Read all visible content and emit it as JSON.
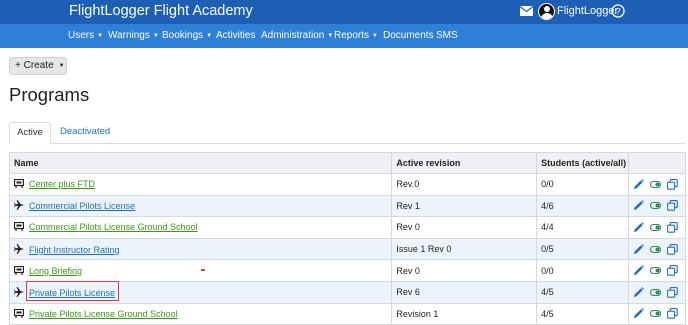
{
  "header": {
    "brand": "FlightLogger Flight Academy",
    "user_name": "FlightLogger"
  },
  "nav": {
    "items": [
      {
        "label": "Users",
        "caret": true
      },
      {
        "label": "Warnings",
        "caret": true
      },
      {
        "label": "Bookings",
        "caret": true
      },
      {
        "label": "Activities",
        "caret": false
      },
      {
        "label": "Administration",
        "caret": true
      },
      {
        "label": "Reports",
        "caret": true
      },
      {
        "label": "Documents",
        "caret": false
      },
      {
        "label": "SMS",
        "caret": false
      }
    ]
  },
  "toolbar": {
    "create_label": "+ Create"
  },
  "page": {
    "title": "Programs"
  },
  "tabs": {
    "active": "Active",
    "deactivated": "Deactivated"
  },
  "table": {
    "headers": {
      "name": "Name",
      "revision": "Active revision",
      "students": "Students (active/all)"
    },
    "rows": [
      {
        "icon": "simulator-icon",
        "name": "Center plus FTD",
        "revision": "Rev.0",
        "students": "0/0",
        "link_color": "green"
      },
      {
        "icon": "airplane-icon",
        "name": "Commercial Pilots License",
        "revision": "Rev 1",
        "students": "4/6",
        "link_color": "blue"
      },
      {
        "icon": "simulator-icon",
        "name": "Commercial Pilots License Ground School",
        "revision": "Rev 0",
        "students": "4/4",
        "link_color": "green"
      },
      {
        "icon": "airplane-icon",
        "name": "Flight Instructor Rating",
        "revision": "Issue 1 Rev 0",
        "students": "0/5",
        "link_color": "blue"
      },
      {
        "icon": "simulator-icon",
        "name": "Long Briefing",
        "revision": "Rev 0",
        "students": "0/0",
        "link_color": "green"
      },
      {
        "icon": "airplane-icon",
        "name": "Private Pilots License",
        "revision": "Rev 6",
        "students": "4/5",
        "link_color": "blue"
      },
      {
        "icon": "simulator-icon",
        "name": "Private Pilots License Ground School",
        "revision": "Revision 1",
        "students": "4/5",
        "link_color": "green"
      }
    ]
  },
  "colors": {
    "header_bg": "#1d5fb5",
    "nav_bg": "#2d7fd8",
    "link_blue": "#1d6fc5",
    "link_green": "#3a9a16",
    "highlight": "#e23a3a"
  }
}
